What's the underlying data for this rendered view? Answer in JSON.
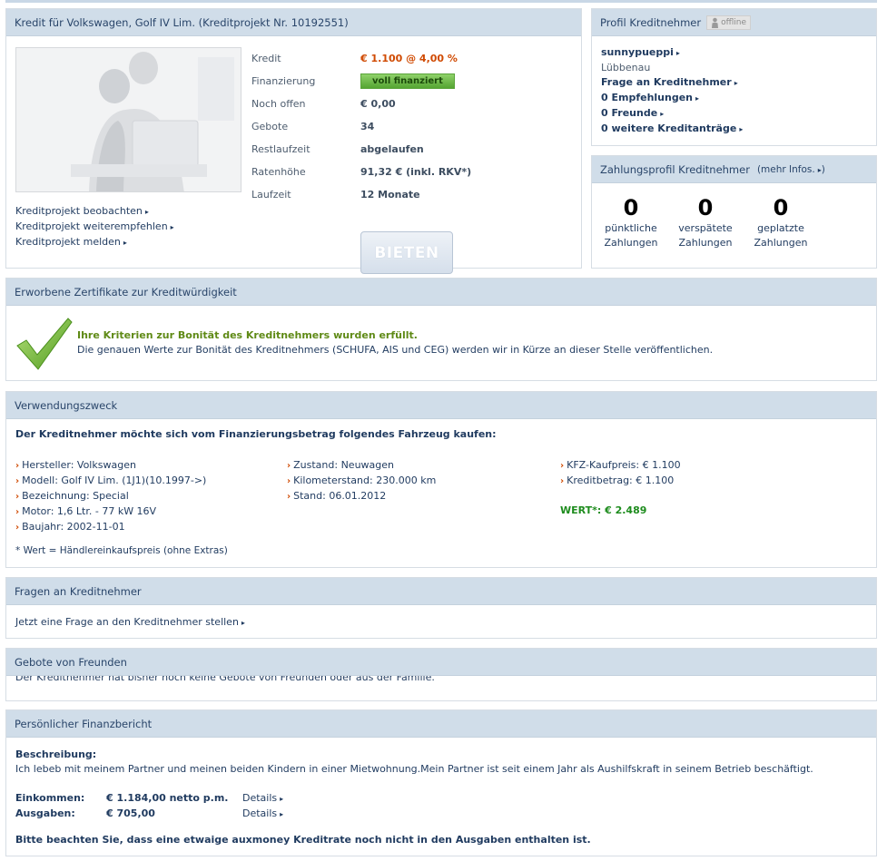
{
  "project": {
    "title": "Kredit für Volkswagen, Golf IV Lim.  (Kreditprojekt Nr. 10192551)",
    "fields": [
      {
        "label": "Kredit",
        "value": "€ 1.100 @ 4,00 %"
      },
      {
        "label": "Finanzierung",
        "value": "voll finanziert"
      },
      {
        "label": "Noch offen",
        "value": "€ 0,00"
      },
      {
        "label": "Gebote",
        "value": "34"
      },
      {
        "label": "Restlaufzeit",
        "value": "abgelaufen"
      },
      {
        "label": "Ratenhöhe",
        "value": "91,32 € (inkl. RKV*)"
      },
      {
        "label": "Laufzeit",
        "value": "12 Monate"
      }
    ],
    "links": [
      "Kreditprojekt beobachten",
      "Kreditprojekt weiterempfehlen",
      "Kreditprojekt melden"
    ],
    "bid_button": "BIETEN"
  },
  "profile": {
    "title": "Profil Kreditnehmer",
    "status": "offline",
    "username": "sunnypueppi",
    "city": "Lübbenau",
    "links": [
      "Frage an Kreditnehmer",
      "0 Empfehlungen",
      "0 Freunde",
      "0 weitere Kreditanträge"
    ]
  },
  "payment": {
    "title": "Zahlungsprofil Kreditnehmer",
    "more": "(mehr Infos.",
    "stats": [
      {
        "count": "0",
        "line1": "pünktliche",
        "line2": "Zahlungen"
      },
      {
        "count": "0",
        "line1": "verspätete",
        "line2": "Zahlungen"
      },
      {
        "count": "0",
        "line1": "geplatzte",
        "line2": "Zahlungen"
      }
    ]
  },
  "certs": {
    "title": "Erworbene Zertifikate zur Kreditwürdigkeit",
    "headline": "Ihre Kriterien zur Bonität des Kreditnehmers wurden erfüllt.",
    "text": "Die genauen Werte zur Bonität des Kreditnehmers (SCHUFA, AIS und CEG) werden wir in Kürze an dieser Stelle veröffentlichen."
  },
  "usage": {
    "title": "Verwendungszweck",
    "intro": "Der Kreditnehmer möchte sich vom Finanzierungsbetrag folgendes Fahrzeug kaufen:",
    "col1": [
      "Hersteller: Volkswagen",
      "Modell: Golf IV Lim. (1J1)(10.1997->)",
      "Bezeichnung: Special",
      "Motor: 1,6 Ltr. - 77 kW 16V",
      "Baujahr: 2002-11-01"
    ],
    "col2": [
      "Zustand: Neuwagen",
      "Kilometerstand: 230.000 km",
      "Stand: 06.01.2012"
    ],
    "col3": [
      "KFZ-Kaufpreis: € 1.100",
      "Kreditbetrag: € 1.100"
    ],
    "wert": "WERT*: € 2.489",
    "footnote": "* Wert = Händlereinkaufspreis (ohne Extras)"
  },
  "questions": {
    "title": "Fragen an Kreditnehmer",
    "link": "Jetzt eine Frage an den Kreditnehmer stellen"
  },
  "friends": {
    "title": "Gebote von Freunden",
    "text": "Der Kreditnehmer hat bisher noch keine Gebote von Freunden oder aus der Familie."
  },
  "finance": {
    "title": "Persönlicher Finanzbericht",
    "desc_label": "Beschreibung:",
    "desc": "Ich lebeb mit meinem Partner und meinen beiden Kindern in einer Mietwohnung.Mein Partner ist seit einem Jahr als Aushilfskraft in seinem Betrieb beschäftigt.",
    "income_label": "Einkommen:",
    "income": "€ 1.184,00 netto p.m.",
    "expense_label": "Ausgaben:",
    "expense": "€ 705,00",
    "details": "Details",
    "note": "Bitte beachten Sie, dass eine etwaige auxmoney Kreditrate noch nicht in den Ausgaben enthalten ist."
  },
  "colors": {
    "accent": "#d04a02",
    "header_bg": "#d0dde9",
    "success": "#1e8c1e"
  }
}
